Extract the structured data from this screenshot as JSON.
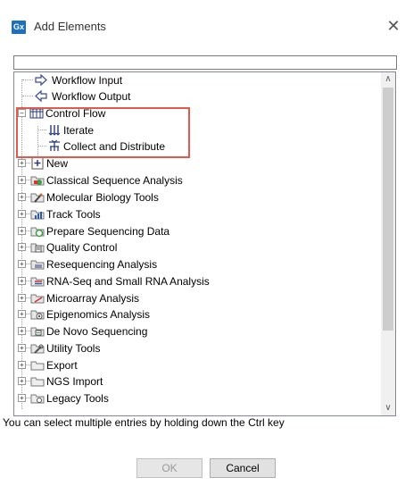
{
  "window": {
    "title": "Add Elements",
    "app_badge": "Gx",
    "close_glyph": "✕"
  },
  "filter": {
    "value": "",
    "placeholder": ""
  },
  "tree": {
    "items": [
      {
        "label": "Workflow Input",
        "icon": "workflow-input-icon",
        "expander": "none"
      },
      {
        "label": "Workflow Output",
        "icon": "workflow-output-icon",
        "expander": "none"
      },
      {
        "label": "Control Flow",
        "icon": "control-flow-icon",
        "expander": "minus"
      },
      {
        "label": "Iterate",
        "icon": "iterate-icon",
        "expander": "none"
      },
      {
        "label": "Collect and Distribute",
        "icon": "collect-distribute-icon",
        "expander": "none"
      },
      {
        "label": "New",
        "icon": "new-icon",
        "expander": "plus"
      },
      {
        "label": "Classical Sequence Analysis",
        "icon": "classical-sequence-icon",
        "expander": "plus"
      },
      {
        "label": "Molecular Biology Tools",
        "icon": "molecular-biology-icon",
        "expander": "plus"
      },
      {
        "label": "Track Tools",
        "icon": "track-tools-icon",
        "expander": "plus"
      },
      {
        "label": "Prepare Sequencing Data",
        "icon": "prepare-sequencing-icon",
        "expander": "plus"
      },
      {
        "label": "Quality Control",
        "icon": "quality-control-icon",
        "expander": "plus"
      },
      {
        "label": "Resequencing Analysis",
        "icon": "resequencing-icon",
        "expander": "plus"
      },
      {
        "label": "RNA-Seq and Small RNA Analysis",
        "icon": "rna-seq-icon",
        "expander": "plus"
      },
      {
        "label": "Microarray Analysis",
        "icon": "microarray-icon",
        "expander": "plus"
      },
      {
        "label": "Epigenomics Analysis",
        "icon": "epigenomics-icon",
        "expander": "plus"
      },
      {
        "label": "De Novo Sequencing",
        "icon": "de-novo-icon",
        "expander": "plus"
      },
      {
        "label": "Utility Tools",
        "icon": "utility-tools-icon",
        "expander": "plus"
      },
      {
        "label": "Export",
        "icon": "export-folder-icon",
        "expander": "plus"
      },
      {
        "label": "NGS Import",
        "icon": "ngs-import-folder-icon",
        "expander": "plus"
      },
      {
        "label": "Legacy Tools",
        "icon": "legacy-tools-folder-icon",
        "expander": "plus"
      }
    ]
  },
  "scrollbar": {
    "up_glyph": "∧",
    "down_glyph": "∨"
  },
  "hint": "You can select multiple entries by holding down the Ctrl key",
  "buttons": {
    "ok": "OK",
    "cancel": "Cancel"
  },
  "colors": {
    "highlight": "#e05a4e",
    "app_badge": "#1d6fc0"
  }
}
